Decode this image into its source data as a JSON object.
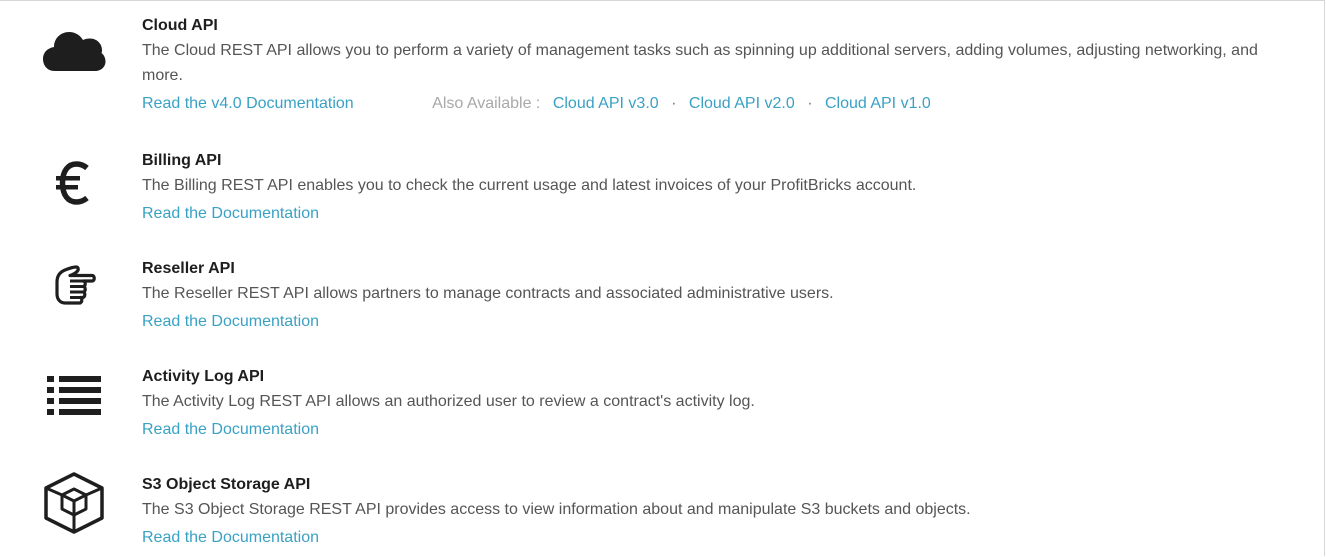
{
  "apis": [
    {
      "icon": "cloud-icon",
      "title": "Cloud API",
      "description": "The Cloud REST API allows you to perform a variety of management tasks such as spinning up additional servers, adding volumes, adjusting networking, and more.",
      "doc_link": "Read the v4.0 Documentation",
      "also_available_label": "Also Available :",
      "versions": [
        "Cloud API v3.0",
        "Cloud API v2.0",
        "Cloud API v1.0"
      ],
      "separator": "·"
    },
    {
      "icon": "euro-icon",
      "title": "Billing API",
      "description": "The Billing REST API enables you to check the current usage and latest invoices of your ProfitBricks account.",
      "doc_link": "Read the Documentation"
    },
    {
      "icon": "hand-pointer-icon",
      "title": "Reseller API",
      "description": "The Reseller REST API allows partners to manage contracts and associated administrative users.",
      "doc_link": "Read the Documentation"
    },
    {
      "icon": "list-icon",
      "title": "Activity Log API",
      "description": "The Activity Log REST API allows an authorized user to review a contract's activity log.",
      "doc_link": "Read the Documentation"
    },
    {
      "icon": "cube-icon",
      "title": "S3 Object Storage API",
      "description": "The S3 Object Storage REST API provides access to view information about and manipulate S3 buckets and objects.",
      "doc_link": "Read the Documentation"
    }
  ],
  "colors": {
    "link": "#3aa1c4",
    "title": "#1e1e1e",
    "text": "#555555",
    "muted": "#a8a8a8",
    "icon": "#1e1e1e"
  }
}
